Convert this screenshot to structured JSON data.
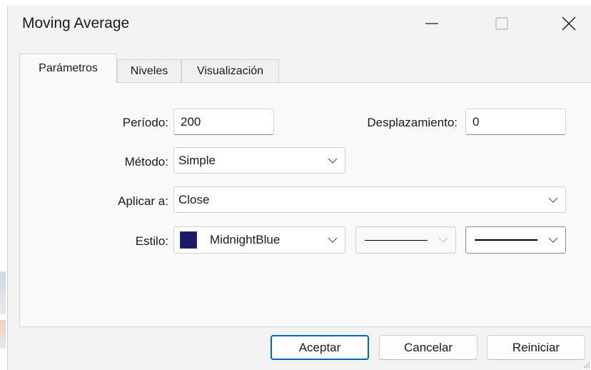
{
  "window": {
    "title": "Moving Average"
  },
  "titlebar_icons": {
    "minimize": "minimize-icon",
    "maximize": "maximize-icon",
    "close": "close-icon"
  },
  "tabs": [
    {
      "label": "Parámetros",
      "active": true
    },
    {
      "label": "Niveles",
      "active": false
    },
    {
      "label": "Visualización",
      "active": false
    }
  ],
  "params": {
    "period_label": "Período:",
    "period_value": "200",
    "shift_label": "Desplazamiento:",
    "shift_value": "0",
    "method_label": "Método:",
    "method_value": "Simple",
    "apply_label": "Aplicar a:",
    "apply_value": "Close",
    "style_label": "Estilo:",
    "color_name": "MidnightBlue",
    "color_hex": "#191970"
  },
  "buttons": {
    "ok": "Aceptar",
    "cancel": "Cancelar",
    "reset": "Reiniciar"
  },
  "colors": {
    "accent": "#0067c0",
    "dialog_bg": "#f3f3f3",
    "panel_bg": "#f9f9f9"
  }
}
